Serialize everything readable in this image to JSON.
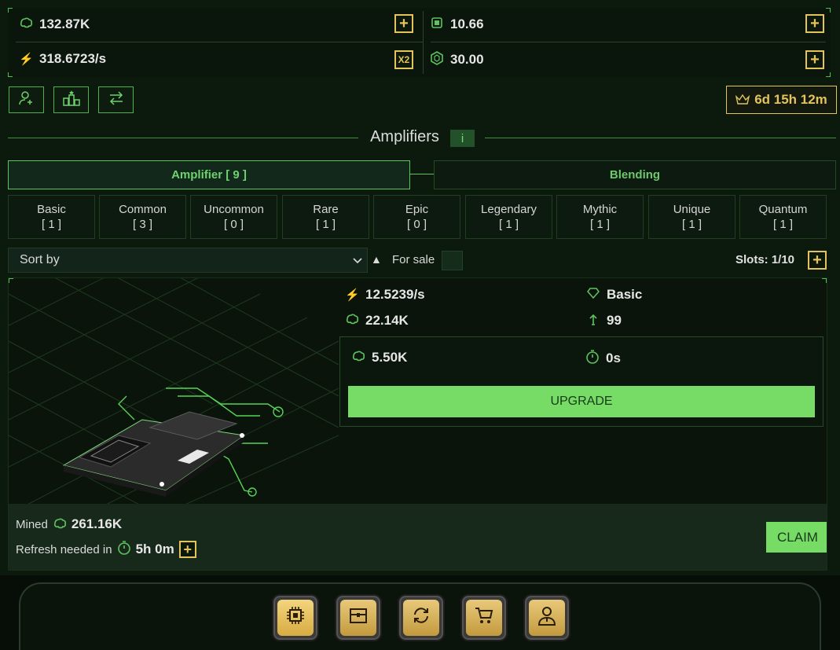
{
  "stats": {
    "brain": "132.87K",
    "rate": "318.6723/s",
    "gems": "10.66",
    "tokens": "30.00",
    "multiplier": "X2",
    "add": "+"
  },
  "timer": "6d 15h 12m",
  "page_title": "Amplifiers",
  "info_label": "i",
  "tabs": {
    "amplifier": "Amplifier [ 9 ]",
    "blending": "Blending"
  },
  "rarities": [
    {
      "name": "Basic",
      "count": "[ 1 ]"
    },
    {
      "name": "Common",
      "count": "[ 3 ]"
    },
    {
      "name": "Uncommon",
      "count": "[ 0 ]"
    },
    {
      "name": "Rare",
      "count": "[ 1 ]"
    },
    {
      "name": "Epic",
      "count": "[ 0 ]"
    },
    {
      "name": "Legendary",
      "count": "[ 1 ]"
    },
    {
      "name": "Mythic",
      "count": "[ 1 ]"
    },
    {
      "name": "Unique",
      "count": "[ 1 ]"
    },
    {
      "name": "Quantum",
      "count": "[ 1 ]"
    }
  ],
  "filter": {
    "sort_label": "Sort by",
    "for_sale": "For sale",
    "slots": "Slots: 1/10"
  },
  "card": {
    "rate": "12.5239/s",
    "rarity": "Basic",
    "brain": "22.14K",
    "level": "99",
    "upgrade_cost": "5.50K",
    "upgrade_time": "0s",
    "upgrade_label": "UPGRADE",
    "mined_label": "Mined",
    "mined_value": "261.16K",
    "refresh_label": "Refresh needed in",
    "refresh_value": "5h 0m",
    "claim_label": "CLAIM"
  },
  "icons": {
    "brain": "brain-icon",
    "bolt": "lightning-icon",
    "gem": "chip-gem-icon",
    "token": "hexagon-token-icon",
    "rarity": "heart-outline-icon",
    "level": "level-up-arrow-icon",
    "timer": "stopwatch-icon"
  },
  "nav": [
    "amplifiers",
    "chest",
    "exchange",
    "shop",
    "profile"
  ]
}
